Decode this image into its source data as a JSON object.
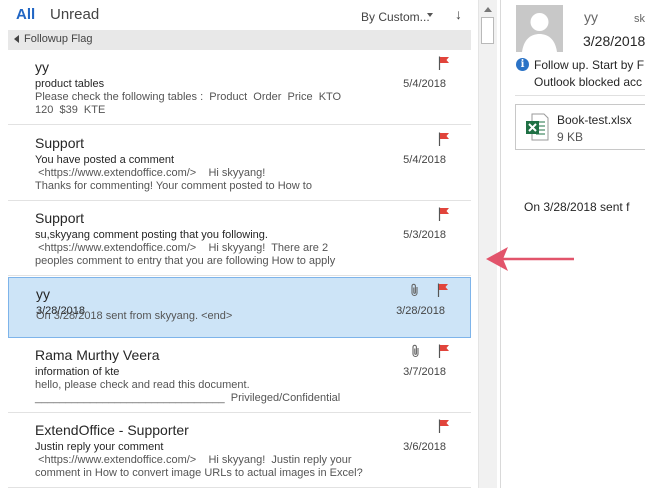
{
  "tabs": {
    "all": "All",
    "unread": "Unread"
  },
  "sort": {
    "label": "By Custom...",
    "direction_glyph": "↓"
  },
  "group": {
    "label": "Followup Flag"
  },
  "colors": {
    "accent": "#2166c4",
    "flag": "#e1443b",
    "selected_bg": "#cde4f7",
    "arrow": "#e2546b",
    "excel": "#1f7044"
  },
  "messages": [
    {
      "sender": "yy",
      "subject": "product tables",
      "date": "5/4/2018",
      "preview": "Please check the following tables :  Product  Order  Price  KTO\n120  $39  KTE",
      "flag_icon": "flag-icon",
      "attachment": false,
      "selected": false
    },
    {
      "sender": "Support",
      "subject": "You have posted a comment",
      "date": "5/4/2018",
      "preview": " <https://www.extendoffice.com/>    Hi skyyang!\nThanks for commenting! Your comment posted to How to",
      "flag_icon": "flag-icon",
      "attachment": false,
      "selected": false
    },
    {
      "sender": "Support",
      "subject": "su,skyyang comment posting that you following.",
      "date": "5/3/2018",
      "preview": " <https://www.extendoffice.com/>    Hi skyyang!  There are 2\npeoples comment to entry that you are following How to apply",
      "flag_icon": "flag-icon",
      "attachment": false,
      "selected": false
    },
    {
      "sender": "yy",
      "subject": "3/28/2018",
      "date": "3/28/2018",
      "preview": "On 3/28/2018 sent from skyyang. <end>",
      "flag_icon": "flag-icon",
      "attachment": true,
      "selected": true
    },
    {
      "sender": "Rama Murthy Veera",
      "subject": "information of kte",
      "date": "3/7/2018",
      "preview": "hello, please check and read this document.\n_______________________________  Privileged/Confidential",
      "flag_icon": "flag-icon",
      "attachment": true,
      "selected": false
    },
    {
      "sender": "ExtendOffice - Supporter",
      "subject": "Justin reply your comment",
      "date": "3/6/2018",
      "preview": " <https://www.extendoffice.com/>    Hi skyyang!  Justin reply your\ncomment in How to convert image URLs to actual images in Excel?",
      "flag_icon": "flag-icon",
      "attachment": false,
      "selected": false
    }
  ],
  "reading": {
    "sender": "yy",
    "sender_trunc": "sk",
    "date": "3/28/2018",
    "info_line1": "Follow up.  Start by F",
    "info_line2": "Outlook blocked acc",
    "attachment_name": "Book-test.xlsx",
    "attachment_size": "9 KB",
    "body": "On 3/28/2018 sent f"
  }
}
